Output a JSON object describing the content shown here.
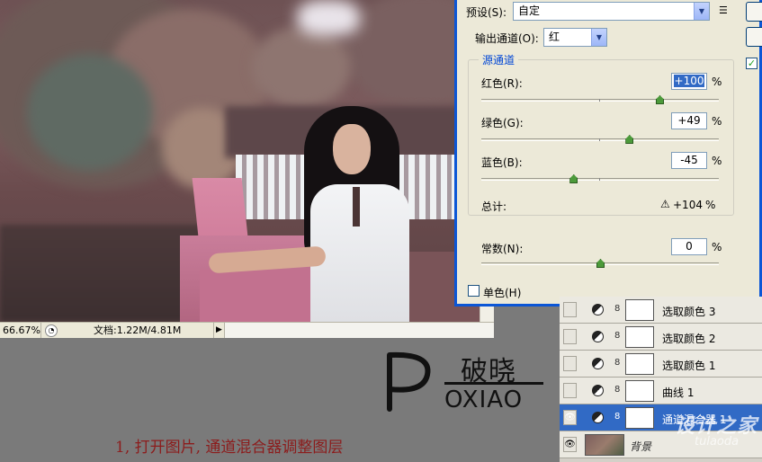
{
  "dialog": {
    "preset_label": "预设(S):",
    "preset_value": "自定",
    "output_label": "输出通道(O):",
    "output_value": "红",
    "source_title": "源通道",
    "red_label": "红色(R):",
    "red_value": "+100",
    "green_label": "绿色(G):",
    "green_value": "+49",
    "blue_label": "蓝色(B):",
    "blue_value": "-45",
    "total_label": "总计:",
    "total_value": "+104",
    "constant_label": "常数(N):",
    "constant_value": "0",
    "percent": "%",
    "mono_label": "单色(H)",
    "sliders": {
      "red": 100,
      "green": 49,
      "blue": -45,
      "constant": 0
    }
  },
  "canvas": {
    "zoom": "66.67%",
    "doc_info": "文档:1.22M/4.81M"
  },
  "layers": [
    {
      "name": "选取颜色 3",
      "visible": false,
      "active": false
    },
    {
      "name": "选取颜色 2",
      "visible": false,
      "active": false
    },
    {
      "name": "选取颜色 1",
      "visible": false,
      "active": false
    },
    {
      "name": "曲线 1",
      "visible": false,
      "active": false
    },
    {
      "name": "通道混合器 1",
      "visible": true,
      "active": true
    },
    {
      "name": "背景",
      "visible": true,
      "active": false
    }
  ],
  "logo": {
    "cn": "破晓",
    "en": "OXIAO"
  },
  "caption": "1, 打开图片, 通道混合器调整图层",
  "watermark": {
    "brand": "设计之家",
    "url": "tulaoda"
  },
  "colors": {
    "dialog_border": "#0b56d6",
    "selection": "#316ac5",
    "caption": "#8c1c1c"
  }
}
